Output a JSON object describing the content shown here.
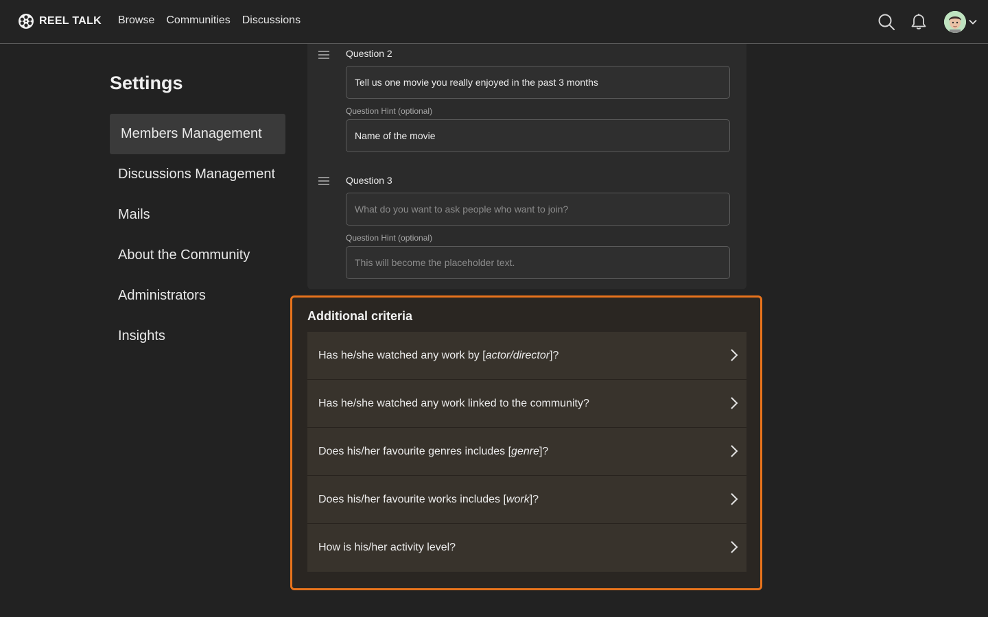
{
  "brand": {
    "name": "REEL TALK"
  },
  "nav": [
    {
      "label": "Browse"
    },
    {
      "label": "Communities"
    },
    {
      "label": "Discussions"
    }
  ],
  "icons": {
    "search": "search-icon",
    "notifications": "bell-icon",
    "menu": "chevron-down-icon",
    "drag": "drag-handle-icon",
    "row_arrow": "chevron-right-icon"
  },
  "settings": {
    "title": "Settings",
    "menu": [
      {
        "label": "Members Management",
        "active": true
      },
      {
        "label": "Discussions Management"
      },
      {
        "label": "Mails"
      },
      {
        "label": "About the Community"
      },
      {
        "label": "Administrators"
      },
      {
        "label": "Insights"
      }
    ]
  },
  "questions": [
    {
      "label": "Question 2",
      "value": "Tell us one movie you really enjoyed in the past 3 months",
      "hint_label": "Question Hint (optional)",
      "hint_value": "Name of the movie"
    },
    {
      "label": "Question 3",
      "placeholder": "What do you want to ask people who want to join?",
      "hint_label": "Question Hint (optional)",
      "hint_placeholder": "This will become the placeholder text."
    }
  ],
  "criteria": {
    "title": "Additional criteria",
    "highlight_color": "#e8731c",
    "items": [
      {
        "before": "Has he/she watched any work by [",
        "italic": "actor/director",
        "after": "]?"
      },
      {
        "before": "Has he/she watched any work linked to the community?",
        "italic": "",
        "after": ""
      },
      {
        "before": "Does his/her favourite genres includes [",
        "italic": "genre",
        "after": "]?"
      },
      {
        "before": "Does his/her favourite works includes [",
        "italic": "work",
        "after": "]?"
      },
      {
        "before": "How is his/her activity level?",
        "italic": "",
        "after": ""
      }
    ]
  }
}
